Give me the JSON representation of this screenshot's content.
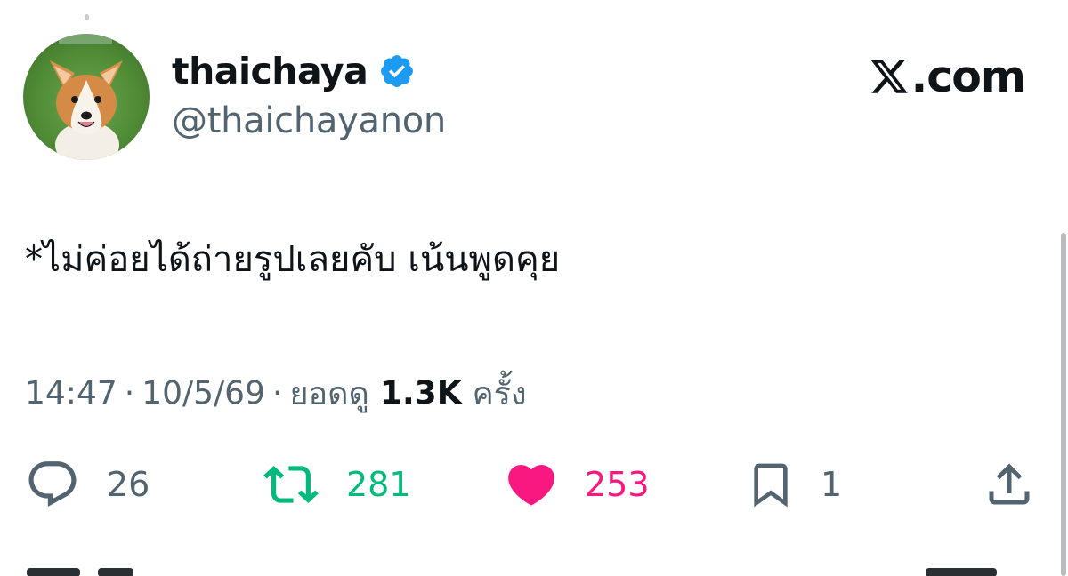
{
  "profile": {
    "display_name": "thaichaya",
    "handle": "@thaichayanon",
    "verified_icon": "verified-badge-icon",
    "avatar_icon": "corgi-avatar"
  },
  "brand": {
    "text": ".com",
    "icon": "x-logo-icon"
  },
  "tweet": {
    "text": "*ไม่ค่อยได้ถ่ายรูปเลยคับ เน้นพูดคุย"
  },
  "meta": {
    "time": "14:47",
    "separator": "·",
    "date": "10/5/69",
    "views_label": "ยอดดู",
    "views_count": "1.3K",
    "views_suffix": "ครั้ง"
  },
  "actions": {
    "reply": {
      "icon": "reply-icon",
      "count": "26"
    },
    "retweet": {
      "icon": "retweet-icon",
      "count": "281"
    },
    "like": {
      "icon": "heart-icon",
      "count": "253"
    },
    "bookmark": {
      "icon": "bookmark-icon",
      "count": "1"
    },
    "share": {
      "icon": "share-icon"
    }
  },
  "colors": {
    "verified": "#1d9bf0",
    "retweet": "#00ba7c",
    "like": "#f91880",
    "secondary_text": "#536471",
    "primary_text": "#0f1419"
  }
}
